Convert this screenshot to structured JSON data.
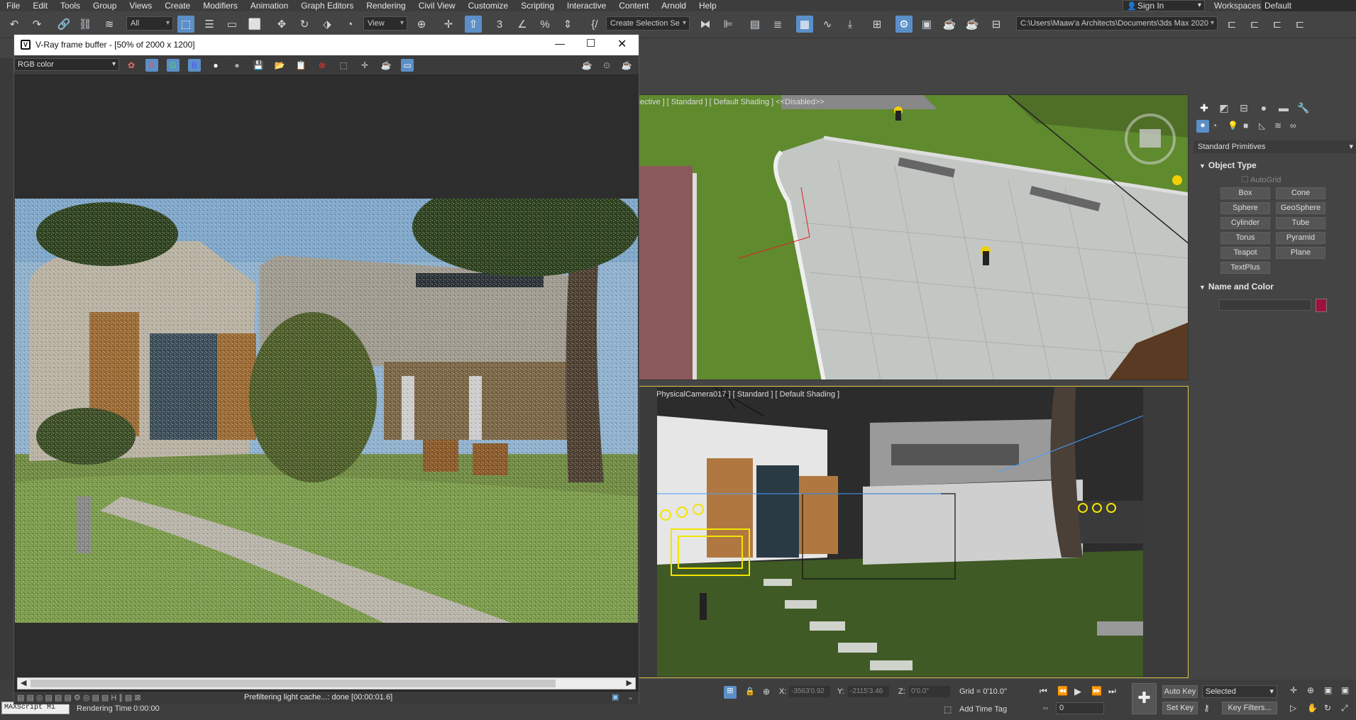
{
  "menu": [
    "File",
    "Edit",
    "Tools",
    "Group",
    "Views",
    "Create",
    "Modifiers",
    "Animation",
    "Graph Editors",
    "Rendering",
    "Civil View",
    "Customize",
    "Scripting",
    "Interactive",
    "Content",
    "Arnold",
    "Help"
  ],
  "account": {
    "sign_in": "Sign In",
    "workspaces_label": "Workspaces:",
    "workspace_value": "Default"
  },
  "toolbar": {
    "filter_value": "All",
    "view_value": "View",
    "selection_set": "Create Selection Se",
    "project_path": "C:\\Users\\Maaw'a Architects\\Documents\\3ds Max 2020"
  },
  "vfb": {
    "title": "V-Ray frame buffer - [50% of 2000 x 1200]",
    "channel": "RGB color",
    "status_text": "Prefiltering light cache...: done [00:00:01.6]"
  },
  "viewports": {
    "top_label": "[ Perspective ] [ Standard ] [ Default Shading ]  <<Disabled>>",
    "bottom_label": "[ VRayPhysicalCamera017 ] [ Standard ] [ Default Shading ]"
  },
  "command_panel": {
    "category": "Standard Primitives",
    "object_type_title": "Object Type",
    "autogrid": "AutoGrid",
    "buttons": [
      "Box",
      "Cone",
      "Sphere",
      "GeoSphere",
      "Cylinder",
      "Tube",
      "Torus",
      "Pyramid",
      "Teapot",
      "Plane",
      "TextPlus"
    ],
    "name_color_title": "Name and Color",
    "color_swatch": "#a0103c"
  },
  "status": {
    "maxscript": "MAXScript Mi",
    "rendering_time_label": "Rendering Time",
    "rendering_time": "0:00:00",
    "x_label": "X:",
    "x_value": "-3563'0.92",
    "y_label": "Y:",
    "y_value": "-2115'3.46",
    "z_label": "Z:",
    "z_value": "0'0.0\"",
    "grid": "Grid = 0'10.0\"",
    "add_time_tag": "Add Time Tag",
    "auto_key": "Auto Key",
    "selected": "Selected",
    "set_key": "Set Key",
    "key_filters": "Key Filters...",
    "frame": "0"
  },
  "colors": {
    "accent": "#5b8fc7",
    "selection_yellow": "#d8c44a"
  }
}
